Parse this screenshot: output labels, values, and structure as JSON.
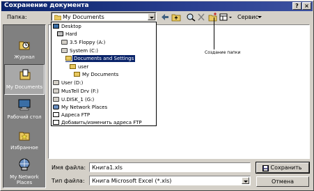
{
  "window": {
    "title": "Сохранение документа",
    "help_btn": "?",
    "close_btn": "×"
  },
  "lookin": {
    "label": "Папка:",
    "value": "My Documents"
  },
  "toolbar": {
    "tools_label": "Сервис"
  },
  "places": [
    {
      "label": "Журнал",
      "icon": "history-icon"
    },
    {
      "label": "My Documents",
      "icon": "my-documents-icon"
    },
    {
      "label": "Рабочий стол",
      "icon": "desktop-icon"
    },
    {
      "label": "Избранное",
      "icon": "favorites-icon"
    },
    {
      "label": "My Network Places",
      "icon": "network-places-icon"
    }
  ],
  "dropdown_items": [
    {
      "label": "Desktop",
      "icon": "desktop"
    },
    {
      "label": "Hard",
      "icon": "pc"
    },
    {
      "label": "3.5 Floppy (A:)",
      "icon": "drive"
    },
    {
      "label": "System (C:)",
      "icon": "drive"
    },
    {
      "label": "Documents and Settings",
      "icon": "folder",
      "selected": true
    },
    {
      "label": "user",
      "icon": "folder"
    },
    {
      "label": "My Documents",
      "icon": "folder"
    },
    {
      "label": "User (D:)",
      "icon": "drive"
    },
    {
      "label": "MusTell Drv (F:)",
      "icon": "drive"
    },
    {
      "label": "U.DISK_1 (G:)",
      "icon": "drive"
    },
    {
      "label": "My Network Places",
      "icon": "net"
    },
    {
      "label": "Адреса FTP",
      "icon": "ftp"
    },
    {
      "label": "Добавить/изменить адреса FTP",
      "icon": "ftp"
    }
  ],
  "annotation": "Создание папки",
  "filename": {
    "label": "Имя файла:",
    "value": "Книга1.xls"
  },
  "filetype": {
    "label": "Тип файла:",
    "value": "Книга Microsoft Excel (*.xls)"
  },
  "buttons": {
    "save": "Сохранить",
    "cancel": "Отмена"
  }
}
